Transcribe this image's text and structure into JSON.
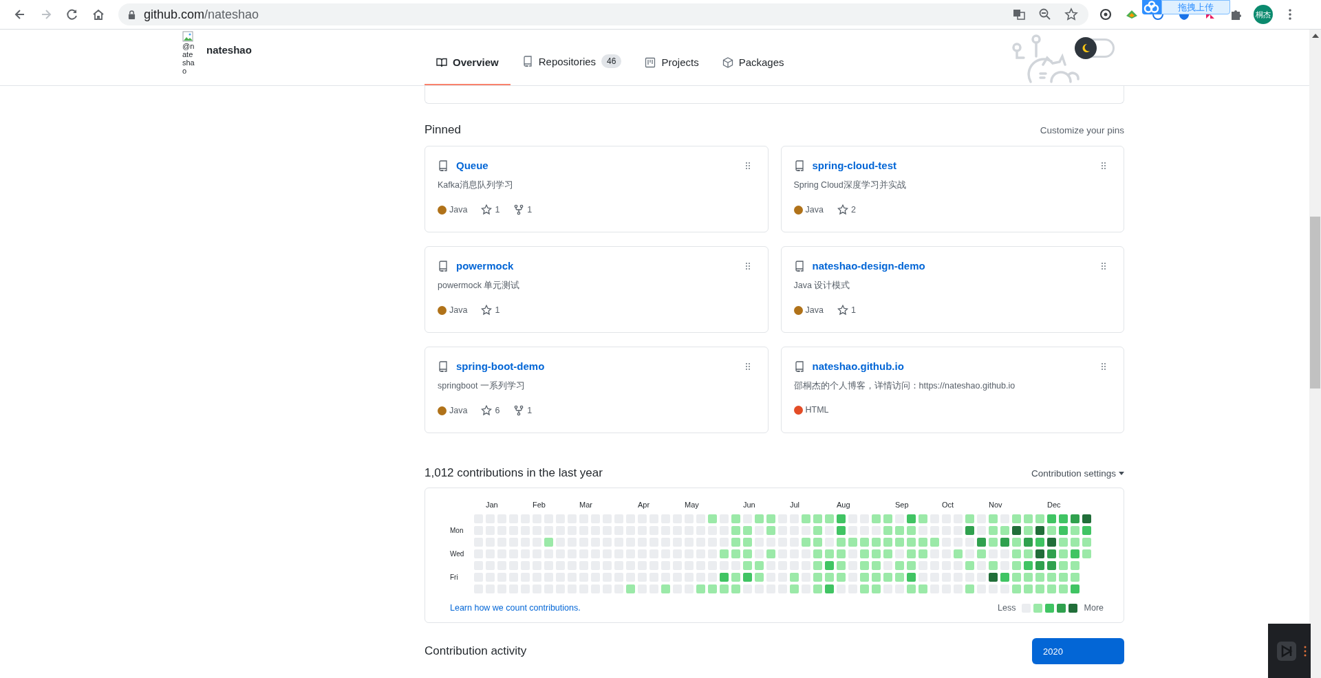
{
  "browser": {
    "url_host": "github.com",
    "url_path": "/nateshao",
    "forward_disabled": true,
    "extension_popup": "拖拽上传",
    "profile_name": "桐杰"
  },
  "profile": {
    "avatar_alt": "@nateshao",
    "username": "nateshao"
  },
  "tabs": [
    {
      "label": "Overview",
      "selected": true
    },
    {
      "label": "Repositories",
      "count": "46",
      "selected": false
    },
    {
      "label": "Projects",
      "selected": false
    },
    {
      "label": "Packages",
      "selected": false
    }
  ],
  "theme_toggle": {
    "dark": false
  },
  "pinned": {
    "title": "Pinned",
    "customize": "Customize your pins",
    "repos": [
      {
        "name": "Queue",
        "description": "Kafka消息队列学习",
        "language": "Java",
        "color": "#b07219",
        "stars": "1",
        "forks": "1"
      },
      {
        "name": "spring-cloud-test",
        "description": "Spring Cloud深度学习并实战",
        "language": "Java",
        "color": "#b07219",
        "stars": "2"
      },
      {
        "name": "powermock",
        "description": "powermock 单元测试",
        "language": "Java",
        "color": "#b07219",
        "stars": "1"
      },
      {
        "name": "nateshao-design-demo",
        "description": "Java 设计模式",
        "language": "Java",
        "color": "#b07219",
        "stars": "1"
      },
      {
        "name": "spring-boot-demo",
        "description": "springboot 一系列学习",
        "language": "Java",
        "color": "#b07219",
        "stars": "6",
        "forks": "1"
      },
      {
        "name": "nateshao.github.io",
        "description": "邵桐杰的个人博客，详情访问：https://nateshao.github.io",
        "language": "HTML",
        "color": "#e34c26"
      }
    ]
  },
  "contributions": {
    "title": "1,012 contributions in the last year",
    "settings": "Contribution settings",
    "months": [
      "Jan",
      "Feb",
      "Mar",
      "Apr",
      "May",
      "Jun",
      "Jul",
      "Aug",
      "Sep",
      "Oct",
      "Nov",
      "Dec"
    ],
    "day_labels": [
      "Mon",
      "Wed",
      "Fri"
    ],
    "rows": [
      [
        {
          "color": "#ebedf0"
        },
        {
          "color": "#ebedf0"
        },
        {
          "color": "#ebedf0"
        },
        {
          "color": "#ebedf0"
        },
        {
          "color": "#ebedf0"
        },
        {
          "color": "#ebedf0"
        },
        {
          "color": "#ebedf0"
        },
        {
          "color": "#ebedf0"
        },
        {
          "color": "#ebedf0"
        },
        {
          "color": "#ebedf0"
        },
        {
          "color": "#ebedf0"
        },
        {
          "color": "#ebedf0"
        },
        {
          "color": "#ebedf0"
        },
        {
          "color": "#ebedf0"
        },
        {
          "color": "#ebedf0"
        },
        {
          "color": "#ebedf0"
        },
        {
          "color": "#ebedf0"
        },
        {
          "color": "#ebedf0"
        },
        {
          "color": "#ebedf0"
        },
        {
          "color": "#ebedf0"
        },
        {
          "color": "#9be9a8"
        },
        {
          "color": "#ebedf0"
        },
        {
          "color": "#9be9a8"
        },
        {
          "color": "#ebedf0"
        },
        {
          "color": "#9be9a8"
        },
        {
          "color": "#9be9a8"
        },
        {
          "color": "#ebedf0"
        },
        {
          "color": "#ebedf0"
        },
        {
          "color": "#9be9a8"
        },
        {
          "color": "#9be9a8"
        },
        {
          "color": "#9be9a8"
        },
        {
          "color": "#40c463"
        },
        {
          "color": "#ebedf0"
        },
        {
          "color": "#ebedf0"
        },
        {
          "color": "#9be9a8"
        },
        {
          "color": "#9be9a8"
        },
        {
          "color": "#ebedf0"
        },
        {
          "color": "#40c463"
        },
        {
          "color": "#9be9a8"
        },
        {
          "color": "#ebedf0"
        },
        {
          "color": "#ebedf0"
        },
        {
          "color": "#ebedf0"
        },
        {
          "color": "#9be9a8"
        },
        {
          "color": "#ebedf0"
        },
        {
          "color": "#9be9a8"
        },
        {
          "color": "#ebedf0"
        },
        {
          "color": "#9be9a8"
        },
        {
          "color": "#9be9a8"
        },
        {
          "color": "#9be9a8"
        },
        {
          "color": "#40c463"
        },
        {
          "color": "#40c463"
        },
        {
          "color": "#30a14e"
        },
        {
          "color": "#216e39"
        }
      ],
      [
        {
          "color": "#ebedf0"
        },
        {
          "color": "#ebedf0"
        },
        {
          "color": "#ebedf0"
        },
        {
          "color": "#ebedf0"
        },
        {
          "color": "#ebedf0"
        },
        {
          "color": "#ebedf0"
        },
        {
          "color": "#ebedf0"
        },
        {
          "color": "#ebedf0"
        },
        {
          "color": "#ebedf0"
        },
        {
          "color": "#ebedf0"
        },
        {
          "color": "#ebedf0"
        },
        {
          "color": "#ebedf0"
        },
        {
          "color": "#ebedf0"
        },
        {
          "color": "#ebedf0"
        },
        {
          "color": "#ebedf0"
        },
        {
          "color": "#ebedf0"
        },
        {
          "color": "#ebedf0"
        },
        {
          "color": "#ebedf0"
        },
        {
          "color": "#ebedf0"
        },
        {
          "color": "#ebedf0"
        },
        {
          "color": "#ebedf0"
        },
        {
          "color": "#ebedf0"
        },
        {
          "color": "#9be9a8"
        },
        {
          "color": "#9be9a8"
        },
        {
          "color": "#ebedf0"
        },
        {
          "color": "#9be9a8"
        },
        {
          "color": "#ebedf0"
        },
        {
          "color": "#ebedf0"
        },
        {
          "color": "#ebedf0"
        },
        {
          "color": "#9be9a8"
        },
        {
          "color": "#ebedf0"
        },
        {
          "color": "#40c463"
        },
        {
          "color": "#ebedf0"
        },
        {
          "color": "#ebedf0"
        },
        {
          "color": "#ebedf0"
        },
        {
          "color": "#9be9a8"
        },
        {
          "color": "#9be9a8"
        },
        {
          "color": "#9be9a8"
        },
        {
          "color": "#ebedf0"
        },
        {
          "color": "#ebedf0"
        },
        {
          "color": "#ebedf0"
        },
        {
          "color": "#ebedf0"
        },
        {
          "color": "#30a14e"
        },
        {
          "color": "#ebedf0"
        },
        {
          "color": "#9be9a8"
        },
        {
          "color": "#9be9a8"
        },
        {
          "color": "#216e39"
        },
        {
          "color": "#9be9a8"
        },
        {
          "color": "#216e39"
        },
        {
          "color": "#9be9a8"
        },
        {
          "color": "#40c463"
        },
        {
          "color": "#9be9a8"
        },
        {
          "color": "#40c463"
        }
      ],
      [
        {
          "color": "#ebedf0"
        },
        {
          "color": "#ebedf0"
        },
        {
          "color": "#ebedf0"
        },
        {
          "color": "#ebedf0"
        },
        {
          "color": "#ebedf0"
        },
        {
          "color": "#ebedf0"
        },
        {
          "color": "#9be9a8"
        },
        {
          "color": "#ebedf0"
        },
        {
          "color": "#ebedf0"
        },
        {
          "color": "#ebedf0"
        },
        {
          "color": "#ebedf0"
        },
        {
          "color": "#ebedf0"
        },
        {
          "color": "#ebedf0"
        },
        {
          "color": "#ebedf0"
        },
        {
          "color": "#ebedf0"
        },
        {
          "color": "#ebedf0"
        },
        {
          "color": "#ebedf0"
        },
        {
          "color": "#ebedf0"
        },
        {
          "color": "#ebedf0"
        },
        {
          "color": "#ebedf0"
        },
        {
          "color": "#ebedf0"
        },
        {
          "color": "#ebedf0"
        },
        {
          "color": "#9be9a8"
        },
        {
          "color": "#9be9a8"
        },
        {
          "color": "#ebedf0"
        },
        {
          "color": "#ebedf0"
        },
        {
          "color": "#ebedf0"
        },
        {
          "color": "#ebedf0"
        },
        {
          "color": "#9be9a8"
        },
        {
          "color": "#9be9a8"
        },
        {
          "color": "#ebedf0"
        },
        {
          "color": "#9be9a8"
        },
        {
          "color": "#9be9a8"
        },
        {
          "color": "#9be9a8"
        },
        {
          "color": "#9be9a8"
        },
        {
          "color": "#9be9a8"
        },
        {
          "color": "#9be9a8"
        },
        {
          "color": "#9be9a8"
        },
        {
          "color": "#9be9a8"
        },
        {
          "color": "#9be9a8"
        },
        {
          "color": "#ebedf0"
        },
        {
          "color": "#ebedf0"
        },
        {
          "color": "#ebedf0"
        },
        {
          "color": "#30a14e"
        },
        {
          "color": "#9be9a8"
        },
        {
          "color": "#30a14e"
        },
        {
          "color": "#9be9a8"
        },
        {
          "color": "#30a14e"
        },
        {
          "color": "#40c463"
        },
        {
          "color": "#216e39"
        },
        {
          "color": "#9be9a8"
        },
        {
          "color": "#9be9a8"
        },
        {
          "color": "#9be9a8"
        }
      ],
      [
        {
          "color": "#ebedf0"
        },
        {
          "color": "#ebedf0"
        },
        {
          "color": "#ebedf0"
        },
        {
          "color": "#ebedf0"
        },
        {
          "color": "#ebedf0"
        },
        {
          "color": "#ebedf0"
        },
        {
          "color": "#ebedf0"
        },
        {
          "color": "#ebedf0"
        },
        {
          "color": "#ebedf0"
        },
        {
          "color": "#ebedf0"
        },
        {
          "color": "#ebedf0"
        },
        {
          "color": "#ebedf0"
        },
        {
          "color": "#ebedf0"
        },
        {
          "color": "#ebedf0"
        },
        {
          "color": "#ebedf0"
        },
        {
          "color": "#ebedf0"
        },
        {
          "color": "#ebedf0"
        },
        {
          "color": "#ebedf0"
        },
        {
          "color": "#ebedf0"
        },
        {
          "color": "#ebedf0"
        },
        {
          "color": "#ebedf0"
        },
        {
          "color": "#9be9a8"
        },
        {
          "color": "#9be9a8"
        },
        {
          "color": "#9be9a8"
        },
        {
          "color": "#ebedf0"
        },
        {
          "color": "#9be9a8"
        },
        {
          "color": "#ebedf0"
        },
        {
          "color": "#ebedf0"
        },
        {
          "color": "#ebedf0"
        },
        {
          "color": "#9be9a8"
        },
        {
          "color": "#9be9a8"
        },
        {
          "color": "#9be9a8"
        },
        {
          "color": "#ebedf0"
        },
        {
          "color": "#9be9a8"
        },
        {
          "color": "#9be9a8"
        },
        {
          "color": "#9be9a8"
        },
        {
          "color": "#ebedf0"
        },
        {
          "color": "#9be9a8"
        },
        {
          "color": "#9be9a8"
        },
        {
          "color": "#ebedf0"
        },
        {
          "color": "#ebedf0"
        },
        {
          "color": "#9be9a8"
        },
        {
          "color": "#ebedf0"
        },
        {
          "color": "#9be9a8"
        },
        {
          "color": "#ebedf0"
        },
        {
          "color": "#ebedf0"
        },
        {
          "color": "#9be9a8"
        },
        {
          "color": "#9be9a8"
        },
        {
          "color": "#216e39"
        },
        {
          "color": "#30a14e"
        },
        {
          "color": "#9be9a8"
        },
        {
          "color": "#40c463"
        },
        {
          "color": "#9be9a8"
        }
      ],
      [
        {
          "color": "#ebedf0"
        },
        {
          "color": "#ebedf0"
        },
        {
          "color": "#ebedf0"
        },
        {
          "color": "#ebedf0"
        },
        {
          "color": "#ebedf0"
        },
        {
          "color": "#ebedf0"
        },
        {
          "color": "#ebedf0"
        },
        {
          "color": "#ebedf0"
        },
        {
          "color": "#ebedf0"
        },
        {
          "color": "#ebedf0"
        },
        {
          "color": "#ebedf0"
        },
        {
          "color": "#ebedf0"
        },
        {
          "color": "#ebedf0"
        },
        {
          "color": "#ebedf0"
        },
        {
          "color": "#ebedf0"
        },
        {
          "color": "#ebedf0"
        },
        {
          "color": "#ebedf0"
        },
        {
          "color": "#ebedf0"
        },
        {
          "color": "#ebedf0"
        },
        {
          "color": "#ebedf0"
        },
        {
          "color": "#ebedf0"
        },
        {
          "color": "#ebedf0"
        },
        {
          "color": "#ebedf0"
        },
        {
          "color": "#9be9a8"
        },
        {
          "color": "#9be9a8"
        },
        {
          "color": "#ebedf0"
        },
        {
          "color": "#ebedf0"
        },
        {
          "color": "#ebedf0"
        },
        {
          "color": "#ebedf0"
        },
        {
          "color": "#9be9a8"
        },
        {
          "color": "#40c463"
        },
        {
          "color": "#9be9a8"
        },
        {
          "color": "#ebedf0"
        },
        {
          "color": "#9be9a8"
        },
        {
          "color": "#9be9a8"
        },
        {
          "color": "#ebedf0"
        },
        {
          "color": "#9be9a8"
        },
        {
          "color": "#9be9a8"
        },
        {
          "color": "#ebedf0"
        },
        {
          "color": "#ebedf0"
        },
        {
          "color": "#ebedf0"
        },
        {
          "color": "#ebedf0"
        },
        {
          "color": "#9be9a8"
        },
        {
          "color": "#ebedf0"
        },
        {
          "color": "#9be9a8"
        },
        {
          "color": "#ebedf0"
        },
        {
          "color": "#9be9a8"
        },
        {
          "color": "#40c463"
        },
        {
          "color": "#30a14e"
        },
        {
          "color": "#30a14e"
        },
        {
          "color": "#9be9a8"
        },
        {
          "color": "#9be9a8"
        }
      ],
      [
        {
          "color": "#ebedf0"
        },
        {
          "color": "#ebedf0"
        },
        {
          "color": "#ebedf0"
        },
        {
          "color": "#ebedf0"
        },
        {
          "color": "#ebedf0"
        },
        {
          "color": "#ebedf0"
        },
        {
          "color": "#ebedf0"
        },
        {
          "color": "#ebedf0"
        },
        {
          "color": "#ebedf0"
        },
        {
          "color": "#ebedf0"
        },
        {
          "color": "#ebedf0"
        },
        {
          "color": "#ebedf0"
        },
        {
          "color": "#ebedf0"
        },
        {
          "color": "#ebedf0"
        },
        {
          "color": "#ebedf0"
        },
        {
          "color": "#ebedf0"
        },
        {
          "color": "#ebedf0"
        },
        {
          "color": "#ebedf0"
        },
        {
          "color": "#ebedf0"
        },
        {
          "color": "#ebedf0"
        },
        {
          "color": "#ebedf0"
        },
        {
          "color": "#40c463"
        },
        {
          "color": "#9be9a8"
        },
        {
          "color": "#40c463"
        },
        {
          "color": "#9be9a8"
        },
        {
          "color": "#ebedf0"
        },
        {
          "color": "#ebedf0"
        },
        {
          "color": "#9be9a8"
        },
        {
          "color": "#ebedf0"
        },
        {
          "color": "#9be9a8"
        },
        {
          "color": "#9be9a8"
        },
        {
          "color": "#9be9a8"
        },
        {
          "color": "#ebedf0"
        },
        {
          "color": "#9be9a8"
        },
        {
          "color": "#9be9a8"
        },
        {
          "color": "#9be9a8"
        },
        {
          "color": "#9be9a8"
        },
        {
          "color": "#40c463"
        },
        {
          "color": "#ebedf0"
        },
        {
          "color": "#ebedf0"
        },
        {
          "color": "#ebedf0"
        },
        {
          "color": "#ebedf0"
        },
        {
          "color": "#ebedf0"
        },
        {
          "color": "#ebedf0"
        },
        {
          "color": "#216e39"
        },
        {
          "color": "#40c463"
        },
        {
          "color": "#9be9a8"
        },
        {
          "color": "#9be9a8"
        },
        {
          "color": "#9be9a8"
        },
        {
          "color": "#9be9a8"
        },
        {
          "color": "#9be9a8"
        },
        {
          "color": "#9be9a8"
        }
      ],
      [
        {
          "color": "#ebedf0"
        },
        {
          "color": "#ebedf0"
        },
        {
          "color": "#ebedf0"
        },
        {
          "color": "#ebedf0"
        },
        {
          "color": "#ebedf0"
        },
        {
          "color": "#ebedf0"
        },
        {
          "color": "#ebedf0"
        },
        {
          "color": "#ebedf0"
        },
        {
          "color": "#ebedf0"
        },
        {
          "color": "#ebedf0"
        },
        {
          "color": "#ebedf0"
        },
        {
          "color": "#ebedf0"
        },
        {
          "color": "#ebedf0"
        },
        {
          "color": "#9be9a8"
        },
        {
          "color": "#ebedf0"
        },
        {
          "color": "#ebedf0"
        },
        {
          "color": "#9be9a8"
        },
        {
          "color": "#ebedf0"
        },
        {
          "color": "#ebedf0"
        },
        {
          "color": "#9be9a8"
        },
        {
          "color": "#9be9a8"
        },
        {
          "color": "#9be9a8"
        },
        {
          "color": "#9be9a8"
        },
        {
          "color": "#ebedf0"
        },
        {
          "color": "#ebedf0"
        },
        {
          "color": "#ebedf0"
        },
        {
          "color": "#ebedf0"
        },
        {
          "color": "#9be9a8"
        },
        {
          "color": "#ebedf0"
        },
        {
          "color": "#9be9a8"
        },
        {
          "color": "#40c463"
        },
        {
          "color": "#ebedf0"
        },
        {
          "color": "#ebedf0"
        },
        {
          "color": "#9be9a8"
        },
        {
          "color": "#9be9a8"
        },
        {
          "color": "#ebedf0"
        },
        {
          "color": "#ebedf0"
        },
        {
          "color": "#9be9a8"
        },
        {
          "color": "#9be9a8"
        },
        {
          "color": "#ebedf0"
        },
        {
          "color": "#ebedf0"
        },
        {
          "color": "#ebedf0"
        },
        {
          "color": "#9be9a8"
        },
        {
          "color": "#ebedf0"
        },
        {
          "color": "#ebedf0"
        },
        {
          "color": "#ebedf0"
        },
        {
          "color": "#9be9a8"
        },
        {
          "color": "#9be9a8"
        },
        {
          "color": "#9be9a8"
        },
        {
          "color": "#9be9a8"
        },
        {
          "color": "#9be9a8"
        },
        {
          "color": "#40c463"
        }
      ]
    ],
    "learn_link": "Learn how we count contributions.",
    "less": "Less",
    "more": "More"
  },
  "activity": {
    "title": "Contribution activity",
    "year": "2020"
  }
}
